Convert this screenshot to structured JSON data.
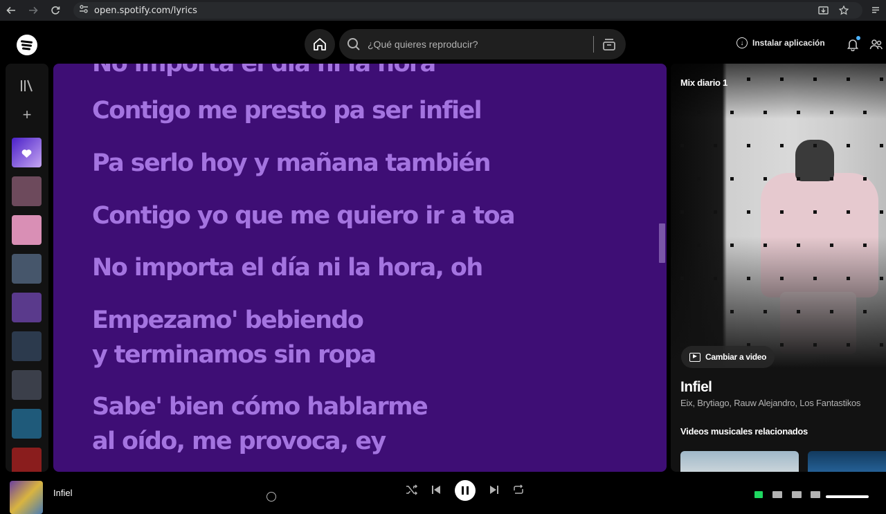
{
  "browser": {
    "url": "open.spotify.com/lyrics"
  },
  "topbar": {
    "search_placeholder": "¿Qué quieres reproducir?",
    "install_label": "Instalar aplicación"
  },
  "library": {
    "tiles": [
      {
        "name": "liked-songs",
        "color": "#7b4ff0"
      },
      {
        "name": "playlist-1",
        "color": "#6d4a5c"
      },
      {
        "name": "playlist-2",
        "color": "#d98fb5"
      },
      {
        "name": "playlist-3",
        "color": "#46566b"
      },
      {
        "name": "playlist-4",
        "color": "#5a3a8c"
      },
      {
        "name": "playlist-5",
        "color": "#2c3a4d"
      },
      {
        "name": "playlist-6",
        "color": "#3b3f4a"
      },
      {
        "name": "playlist-7",
        "color": "#1f5a7a"
      },
      {
        "name": "playlist-8",
        "color": "#8a1d1d"
      }
    ]
  },
  "lyrics": {
    "lines": [
      {
        "text": "No importa el día ni la hora",
        "active": false
      },
      {
        "text": "Contigo me presto pa ser infiel",
        "active": false
      },
      {
        "text": "Pa serlo hoy y mañana también",
        "active": false
      },
      {
        "text": "Contigo yo que me quiero ir a toa",
        "active": false
      },
      {
        "text": "No importa el día ni la hora, oh",
        "active": true
      },
      {
        "text": "Empezamo' bebiendo",
        "active": false
      },
      {
        "text": "y terminamos sin ropa",
        "active": false
      },
      {
        "text": "Sabe' bien cómo hablarme",
        "active": false
      },
      {
        "text": "al oído, me provoca, ey",
        "active": false
      }
    ],
    "background": "#3e0e75",
    "inactive_color": "#a474e0",
    "active_color": "#ffffff"
  },
  "now_playing": {
    "context": "Mix diario 1",
    "video_button": "Cambiar a video",
    "title": "Infiel",
    "artists": "Eix, Brytiago, Rauw Alejandro, Los Fantastikos",
    "related_header": "Videos musicales relacionados"
  },
  "player": {
    "title": "Infiel"
  }
}
